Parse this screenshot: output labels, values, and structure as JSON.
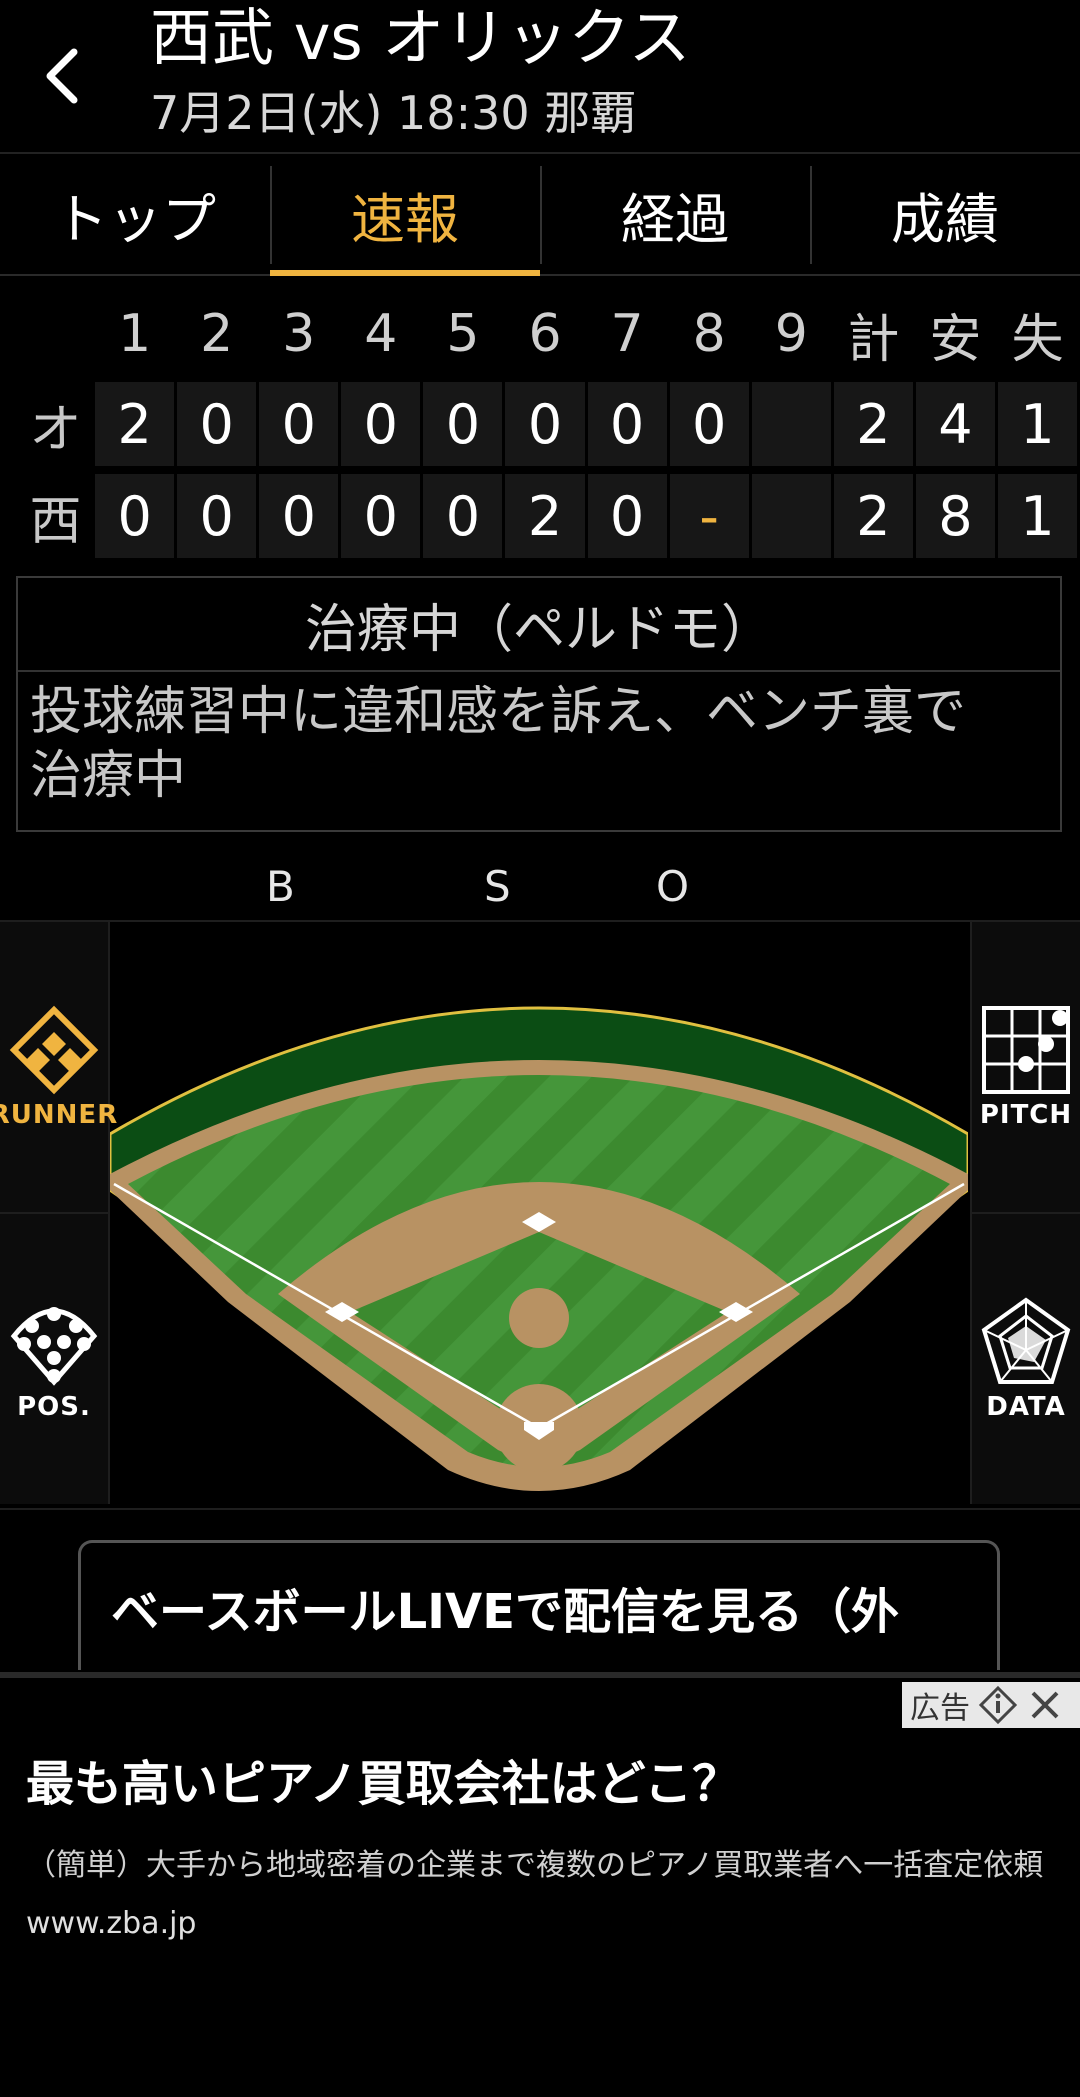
{
  "header": {
    "title": "西武 vs オリックス",
    "subtitle": "7月2日(水) 18:30 那覇"
  },
  "tabs": [
    {
      "label": "トップ",
      "active": false
    },
    {
      "label": "速報",
      "active": true
    },
    {
      "label": "経過",
      "active": false
    },
    {
      "label": "成績",
      "active": false
    }
  ],
  "scoreboard": {
    "headers": [
      "1",
      "2",
      "3",
      "4",
      "5",
      "6",
      "7",
      "8",
      "9",
      "計",
      "安",
      "失"
    ],
    "rows": [
      {
        "team": "オ",
        "cells": [
          "2",
          "0",
          "0",
          "0",
          "0",
          "0",
          "0",
          "0",
          "",
          "2",
          "4",
          "1"
        ]
      },
      {
        "team": "西",
        "cells": [
          "0",
          "0",
          "0",
          "0",
          "0",
          "2",
          "0",
          "-",
          "",
          "2",
          "8",
          "1"
        ]
      }
    ]
  },
  "event": {
    "title": "治療中（ペルドモ）",
    "desc_line1": "投球練習中に違和感を訴え、ベンチ裏で",
    "desc_line2": "治療中"
  },
  "bso": {
    "b": "B",
    "s": "S",
    "o": "O"
  },
  "side_buttons": {
    "runner": "RUNNER",
    "pos": "POS.",
    "pitch": "PITCH",
    "data": "DATA"
  },
  "live_button": "ベースボールLIVEで配信を見る（外",
  "ad": {
    "badge": "広告",
    "title": "最も高いピアノ買取会社はどこ？",
    "desc": "（簡単）大手から地域密着の企業まで複数のピアノ買取業者へ一括査定依頼",
    "url": "www.zba.jp"
  },
  "colors": {
    "accent": "#f0b440",
    "grass": "#3b8a2e",
    "dirt": "#b89263",
    "background": "#000000"
  }
}
